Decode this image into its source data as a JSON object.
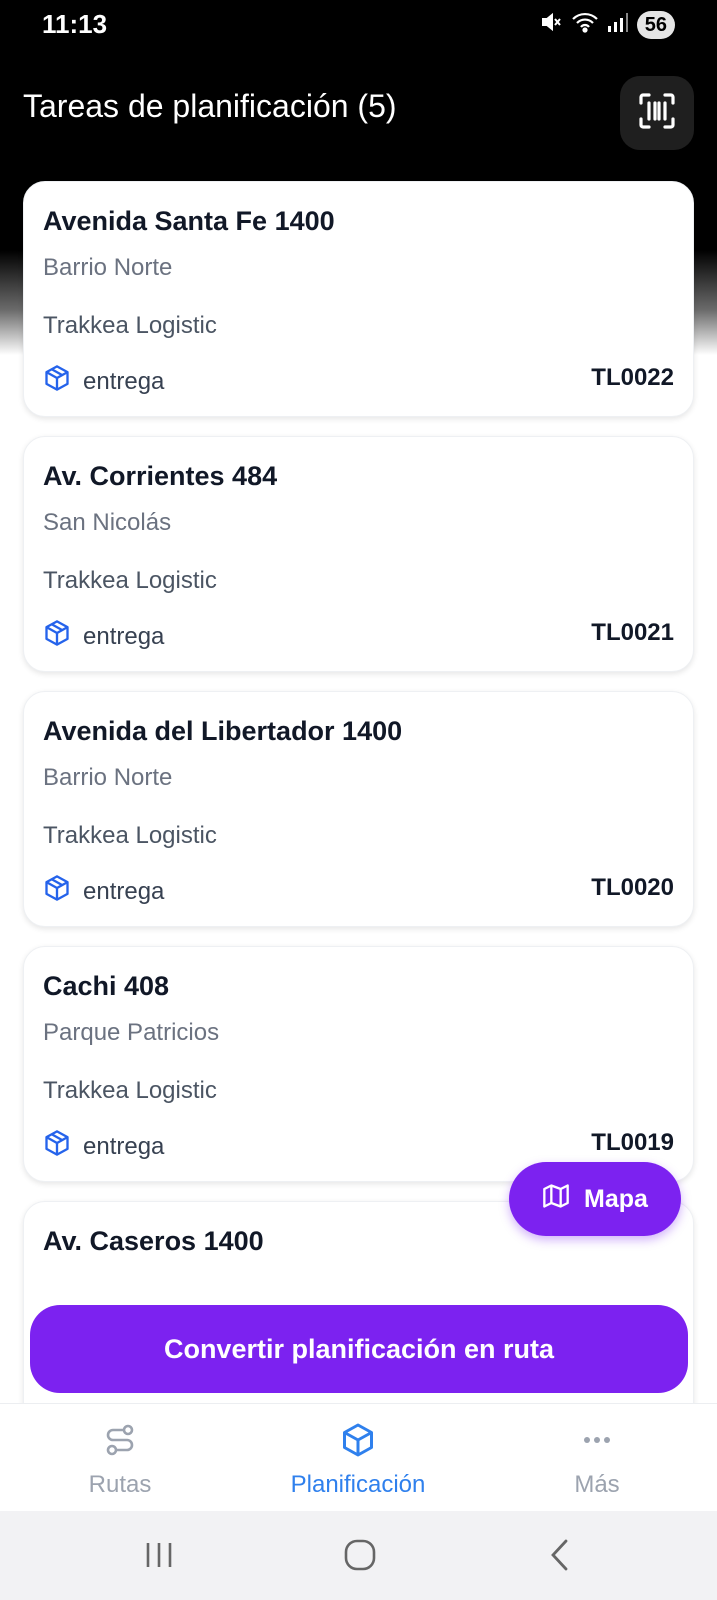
{
  "status_bar": {
    "time": "11:13",
    "battery": "56"
  },
  "header": {
    "title": "Tareas de planificación (5)"
  },
  "tasks": [
    {
      "address": "Avenida Santa Fe 1400",
      "neighborhood": "Barrio Norte",
      "company": "Trakkea Logistic",
      "type": "entrega",
      "code": "TL0022"
    },
    {
      "address": "Av. Corrientes 484",
      "neighborhood": "San Nicolás",
      "company": "Trakkea Logistic",
      "type": "entrega",
      "code": "TL0021"
    },
    {
      "address": "Avenida del Libertador 1400",
      "neighborhood": "Barrio Norte",
      "company": "Trakkea Logistic",
      "type": "entrega",
      "code": "TL0020"
    },
    {
      "address": "Cachi 408",
      "neighborhood": "Parque Patricios",
      "company": "Trakkea Logistic",
      "type": "entrega",
      "code": "TL0019"
    },
    {
      "address": "Av. Caseros 1400",
      "neighborhood": "",
      "company": "",
      "type": "",
      "code": ""
    }
  ],
  "map_button": {
    "label": "Mapa"
  },
  "convert_button": {
    "label": "Convertir planificación en ruta"
  },
  "bottom_nav": [
    {
      "label": "Rutas",
      "active": false
    },
    {
      "label": "Planificación",
      "active": true
    },
    {
      "label": "Más",
      "active": false
    }
  ],
  "colors": {
    "accent": "#7c22f0",
    "active_nav": "#2f80ed",
    "inactive_nav": "#9ca3af",
    "package_icon": "#2563eb",
    "header_bg": "#000000"
  },
  "icons": {
    "scan": "barcode-scan-icon",
    "task_type": "package-icon",
    "map": "map-icon",
    "nav_routes": "route-icon",
    "nav_planning": "package-icon",
    "nav_more": "more-dots-icon"
  }
}
